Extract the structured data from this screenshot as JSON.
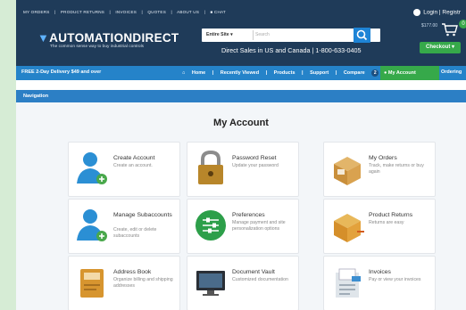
{
  "header": {
    "top_links": [
      "MY ORDERS",
      "|",
      "PRODUCT RETURNS",
      "|",
      "INVOICES",
      "|",
      "QUOTES",
      "|",
      "ABOUT US",
      "|",
      "CHAT"
    ],
    "login_label": "Login | Registr",
    "logo": "AUTOMATIONDIRECT",
    "tagline": "The common sense way to buy industrial controls",
    "search_select": "Entire Site",
    "search_placeholder": "Search",
    "phone": "Direct Sales in US and Canada  |  1-800-633-0405",
    "cart_amount": "$177.00",
    "cart_count": "0",
    "checkout_label": "Checkout"
  },
  "navbar": {
    "promo": "FREE 2-Day Delivery $49 and over",
    "links": [
      "Home",
      "|",
      "Recently Viewed",
      "|",
      "Products",
      "|",
      "Support",
      "|",
      "Compare"
    ],
    "compare_count": "2",
    "account_label": "My Account",
    "ordering_label": "Ordering"
  },
  "navigation_label": "Navigation",
  "page_title": "My Account",
  "cards": [
    {
      "title": "Create Account",
      "desc": "Create an account."
    },
    {
      "title": "Password Reset",
      "desc": "Update your password"
    },
    {
      "title": "My Orders",
      "desc": "Track, make returns or buy again"
    },
    {
      "title": "Manage Subaccounts",
      "desc": "Create, edit or delete subaccounts"
    },
    {
      "title": "Preferences",
      "desc": "Manage payment and site personalization options"
    },
    {
      "title": "Product Returns",
      "desc": "Returns are easy"
    },
    {
      "title": "Address Book",
      "desc": "Organize billing and shipping addresses"
    },
    {
      "title": "Document Vault",
      "desc": "Customized documentation"
    },
    {
      "title": "Invoices",
      "desc": "Pay or view your invoices"
    }
  ],
  "colors": {
    "header": "#1f3b59",
    "nav": "#2583c9",
    "accent_green": "#36a94a"
  }
}
